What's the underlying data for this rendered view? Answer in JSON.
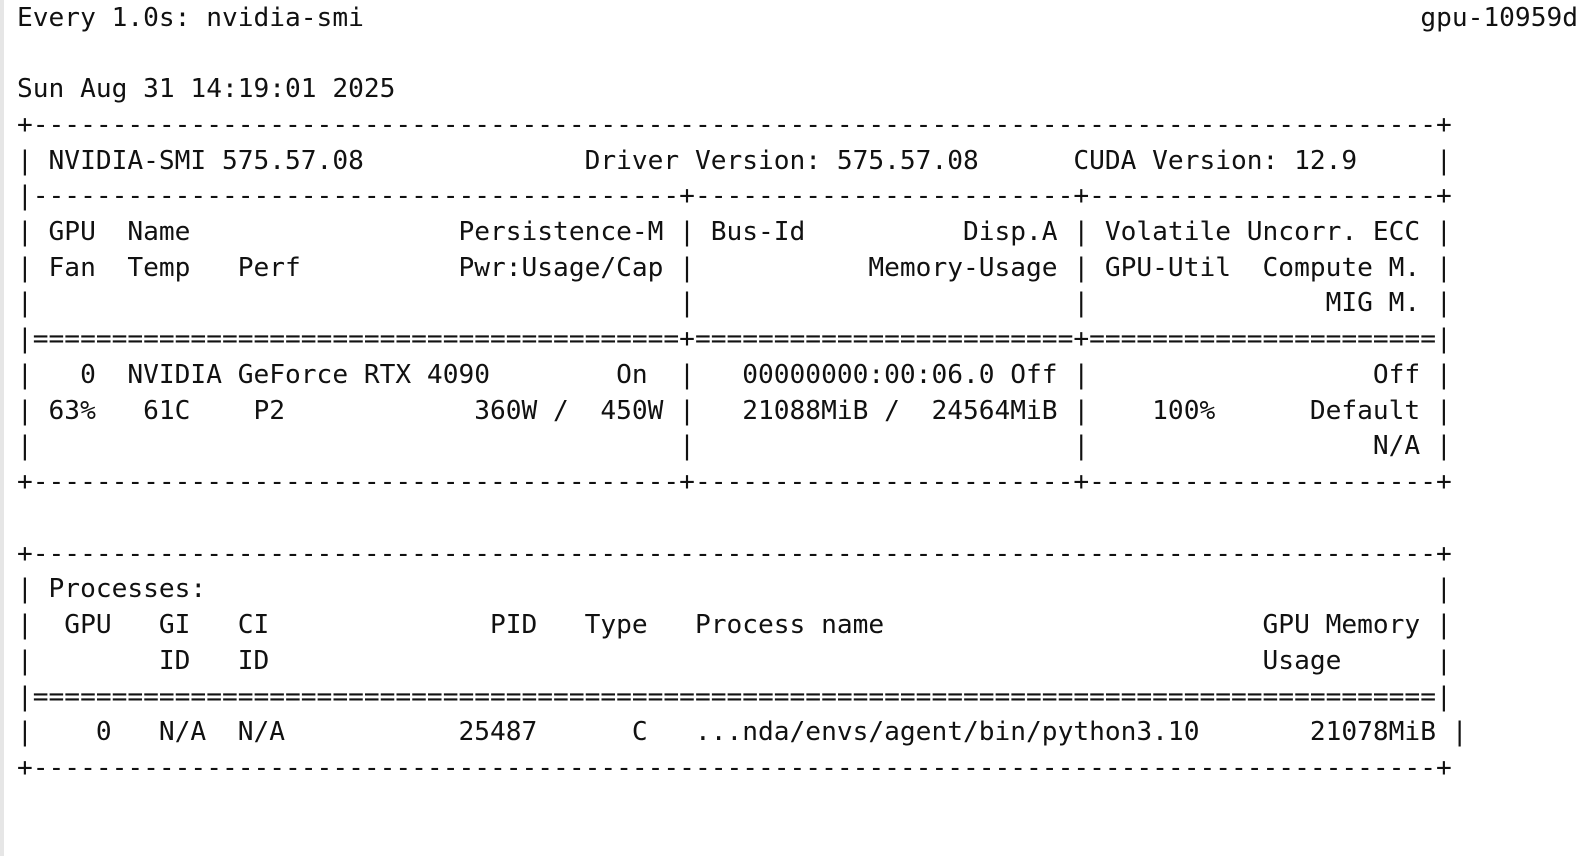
{
  "watch": {
    "command": "Every 1.0s: nvidia-smi",
    "host": "gpu-10959d",
    "timestamp": "Sun Aug 31 14:19:01 2025"
  },
  "smi": {
    "border_top": "+-----------------------------------------------------------------------------------------+",
    "version_line": "| NVIDIA-SMI 575.57.08              Driver Version: 575.57.08      CUDA Version: 12.9     |",
    "sep_cols": "|-----------------------------------------+------------------------+----------------------+",
    "head_1": "| GPU  Name                 Persistence-M | Bus-Id          Disp.A | Volatile Uncorr. ECC |",
    "head_2": "| Fan  Temp   Perf          Pwr:Usage/Cap |           Memory-Usage | GPU-Util  Compute M. |",
    "head_3": "|                                         |                        |               MIG M. |",
    "sep_double": "|=========================================+========================+======================|",
    "gpu_1": "|   0  NVIDIA GeForce RTX 4090        On  |   00000000:00:06.0 Off |                  Off |",
    "gpu_2": "| 63%   61C    P2            360W /  450W |   21088MiB /  24564MiB |    100%      Default |",
    "gpu_3": "|                                         |                        |                  N/A |",
    "border_cols": "+-----------------------------------------+------------------------+----------------------+"
  },
  "processes": {
    "border_top": "+-----------------------------------------------------------------------------------------+",
    "title": "| Processes:                                                                              |",
    "head_1": "|  GPU   GI   CI              PID   Type   Process name                        GPU Memory |",
    "head_2": "|        ID   ID                                                               Usage      |",
    "sep_double": "|=========================================================================================|",
    "row_1": "|    0   N/A  N/A           25487      C   ...nda/envs/agent/bin/python3.10       21078MiB |",
    "border_bottom": "+-----------------------------------------------------------------------------------------+"
  }
}
